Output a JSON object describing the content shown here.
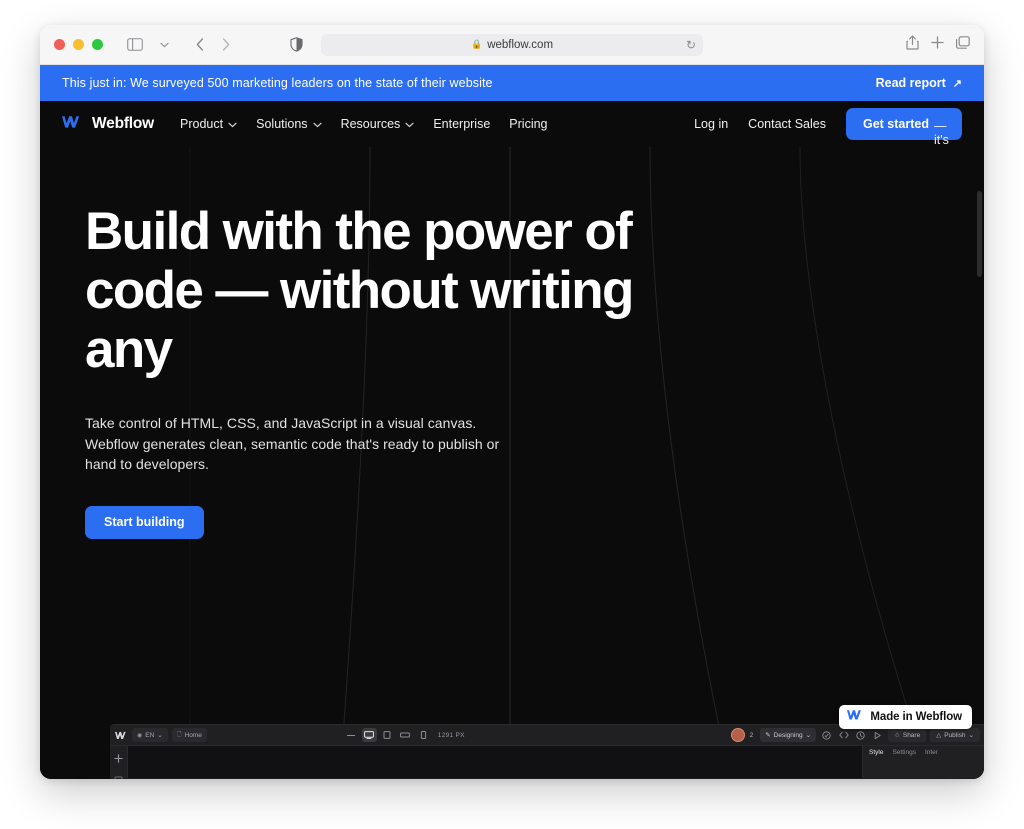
{
  "browser": {
    "traffic_lights": [
      "close",
      "minimize",
      "zoom"
    ],
    "sidebar_icon": "sidebar-icon",
    "back_label": "‹",
    "forward_label": "›",
    "shield_icon": "privacy-shield-icon",
    "url": "webflow.com",
    "lock_icon": "lock-icon",
    "reload_icon": "reload-icon",
    "share_icon": "share-icon",
    "new_tab_icon": "plus-icon",
    "tabs_icon": "tab-overview-icon"
  },
  "banner": {
    "text": "This just in: We surveyed 500 marketing leaders on the state of their website",
    "cta_label": "Read report",
    "cta_arrow": "↗",
    "background": "#2c6ef2"
  },
  "nav": {
    "brand": "Webflow",
    "links": [
      {
        "label": "Product",
        "has_chevron": true
      },
      {
        "label": "Solutions",
        "has_chevron": true
      },
      {
        "label": "Resources",
        "has_chevron": true
      },
      {
        "label": "Enterprise",
        "has_chevron": false
      },
      {
        "label": "Pricing",
        "has_chevron": false
      }
    ],
    "login_label": "Log in",
    "contact_label": "Contact Sales",
    "cta_strong": "Get started",
    "cta_light": "— it's free",
    "cta_color": "#2c6ef2"
  },
  "hero": {
    "headline": "Build with the power of code — without writing any",
    "subhead": "Take control of HTML, CSS, and JavaScript in a visual canvas. Webflow generates clean, semantic code that's ready to publish or hand to developers.",
    "cta_label": "Start building",
    "background": "#0b0b0b"
  },
  "designer": {
    "logo_icon": "webflow-logo-icon",
    "locale_chip": {
      "icon": "globe-icon",
      "label": "EN",
      "chevron": "⌄"
    },
    "page_chip": {
      "icon": "page-icon",
      "label": "Home"
    },
    "collapse_icon": "minus-icon",
    "viewports": [
      {
        "name": "desktop",
        "icon": "desktop-icon",
        "active": true
      },
      {
        "name": "tablet",
        "icon": "tablet-icon",
        "active": false
      },
      {
        "name": "mobile-landscape",
        "icon": "mobile-landscape-icon",
        "active": false
      },
      {
        "name": "mobile-portrait",
        "icon": "mobile-portrait-icon",
        "active": false
      }
    ],
    "viewport_width": "1291 PX",
    "collaborator_count": "2",
    "mode_chip": {
      "icon": "pencil-icon",
      "label": "Designing",
      "chevron": "⌄"
    },
    "toolbar_icons": [
      "audit-icon",
      "code-icon",
      "clock-icon",
      "preview-icon"
    ],
    "share_button": {
      "icon": "person-icon",
      "label": "Share"
    },
    "publish_button": {
      "icon": "rocket-icon",
      "label": "Publish",
      "chevron": "⌄"
    },
    "left_tools": [
      "plus-icon",
      "pages-icon"
    ],
    "panel_tabs": [
      {
        "label": "Style",
        "active": true
      },
      {
        "label": "Settings",
        "active": false
      },
      {
        "label": "Inter",
        "active": false
      }
    ]
  },
  "badge": {
    "label": "Made in Webflow",
    "icon": "webflow-logo-icon"
  }
}
